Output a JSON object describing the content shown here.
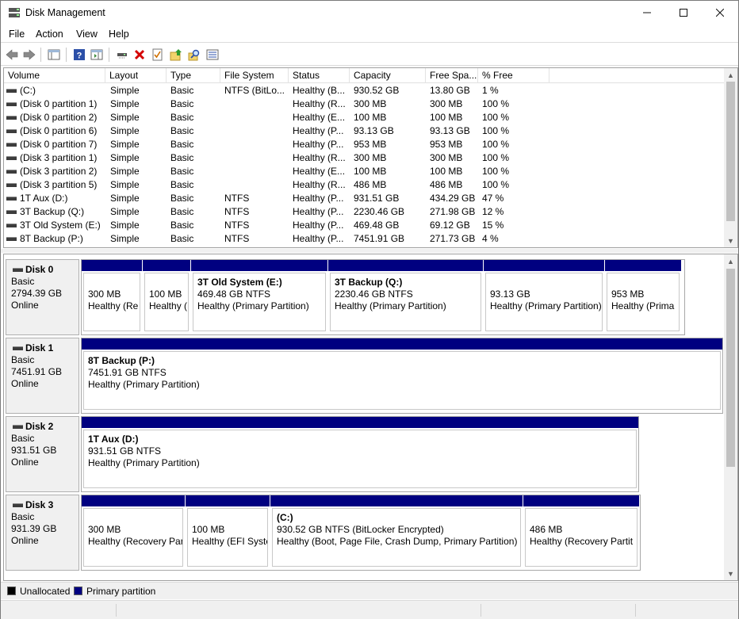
{
  "window": {
    "title": "Disk Management"
  },
  "menu": [
    "File",
    "Action",
    "View",
    "Help"
  ],
  "toolbar": {
    "icons": [
      "back-arrow-icon",
      "forward-arrow-icon",
      "console-tree-icon",
      "help-icon",
      "action-pane-icon",
      "connect-icon",
      "delete-icon",
      "properties-icon",
      "import-icon",
      "search-icon",
      "list-view-icon"
    ]
  },
  "columns": [
    "Volume",
    "Layout",
    "Type",
    "File System",
    "Status",
    "Capacity",
    "Free Spa...",
    "% Free"
  ],
  "volumes": [
    {
      "volume": "(C:)",
      "layout": "Simple",
      "type": "Basic",
      "fs": "NTFS (BitLo...",
      "status": "Healthy (B...",
      "capacity": "930.52 GB",
      "free": "13.80 GB",
      "pct": "1 %"
    },
    {
      "volume": "(Disk 0 partition 1)",
      "layout": "Simple",
      "type": "Basic",
      "fs": "",
      "status": "Healthy (R...",
      "capacity": "300 MB",
      "free": "300 MB",
      "pct": "100 %"
    },
    {
      "volume": "(Disk 0 partition 2)",
      "layout": "Simple",
      "type": "Basic",
      "fs": "",
      "status": "Healthy (E...",
      "capacity": "100 MB",
      "free": "100 MB",
      "pct": "100 %"
    },
    {
      "volume": "(Disk 0 partition 6)",
      "layout": "Simple",
      "type": "Basic",
      "fs": "",
      "status": "Healthy (P...",
      "capacity": "93.13 GB",
      "free": "93.13 GB",
      "pct": "100 %"
    },
    {
      "volume": "(Disk 0 partition 7)",
      "layout": "Simple",
      "type": "Basic",
      "fs": "",
      "status": "Healthy (P...",
      "capacity": "953 MB",
      "free": "953 MB",
      "pct": "100 %"
    },
    {
      "volume": "(Disk 3 partition 1)",
      "layout": "Simple",
      "type": "Basic",
      "fs": "",
      "status": "Healthy (R...",
      "capacity": "300 MB",
      "free": "300 MB",
      "pct": "100 %"
    },
    {
      "volume": "(Disk 3 partition 2)",
      "layout": "Simple",
      "type": "Basic",
      "fs": "",
      "status": "Healthy (E...",
      "capacity": "100 MB",
      "free": "100 MB",
      "pct": "100 %"
    },
    {
      "volume": "(Disk 3 partition 5)",
      "layout": "Simple",
      "type": "Basic",
      "fs": "",
      "status": "Healthy (R...",
      "capacity": "486 MB",
      "free": "486 MB",
      "pct": "100 %"
    },
    {
      "volume": "1T Aux (D:)",
      "layout": "Simple",
      "type": "Basic",
      "fs": "NTFS",
      "status": "Healthy (P...",
      "capacity": "931.51 GB",
      "free": "434.29 GB",
      "pct": "47 %"
    },
    {
      "volume": "3T Backup (Q:)",
      "layout": "Simple",
      "type": "Basic",
      "fs": "NTFS",
      "status": "Healthy (P...",
      "capacity": "2230.46 GB",
      "free": "271.98 GB",
      "pct": "12 %"
    },
    {
      "volume": "3T Old System (E:)",
      "layout": "Simple",
      "type": "Basic",
      "fs": "NTFS",
      "status": "Healthy (P...",
      "capacity": "469.48 GB",
      "free": "69.12 GB",
      "pct": "15 %"
    },
    {
      "volume": "8T Backup (P:)",
      "layout": "Simple",
      "type": "Basic",
      "fs": "NTFS",
      "status": "Healthy (P...",
      "capacity": "7451.91 GB",
      "free": "271.73 GB",
      "pct": "4 %"
    }
  ],
  "disks": [
    {
      "name": "Disk 0",
      "type": "Basic",
      "size": "2794.39 GB",
      "state": "Online",
      "partitions": [
        {
          "title": "",
          "size": "300 MB",
          "status": "Healthy (Re"
        },
        {
          "title": "",
          "size": "100 MB",
          "status": "Healthy (E"
        },
        {
          "title": "3T Old System  (E:)",
          "size": "469.48 GB NTFS",
          "status": "Healthy (Primary Partition)"
        },
        {
          "title": "3T Backup  (Q:)",
          "size": "2230.46 GB NTFS",
          "status": "Healthy (Primary Partition)"
        },
        {
          "title": "",
          "size": "93.13 GB",
          "status": "Healthy (Primary Partition)"
        },
        {
          "title": "",
          "size": "953 MB",
          "status": "Healthy (Prima"
        }
      ]
    },
    {
      "name": "Disk 1",
      "type": "Basic",
      "size": "7451.91 GB",
      "state": "Online",
      "partitions": [
        {
          "title": "8T Backup   (P:)",
          "size": "7451.91 GB NTFS",
          "status": "Healthy (Primary Partition)"
        }
      ]
    },
    {
      "name": "Disk 2",
      "type": "Basic",
      "size": "931.51 GB",
      "state": "Online",
      "partitions": [
        {
          "title": "1T Aux  (D:)",
          "size": "931.51 GB NTFS",
          "status": "Healthy (Primary Partition)"
        }
      ]
    },
    {
      "name": "Disk 3",
      "type": "Basic",
      "size": "931.39 GB",
      "state": "Online",
      "partitions": [
        {
          "title": "",
          "size": "300 MB",
          "status": "Healthy (Recovery Par"
        },
        {
          "title": "",
          "size": "100 MB",
          "status": "Healthy (EFI Syste"
        },
        {
          "title": "(C:)",
          "size": "930.52 GB NTFS (BitLocker Encrypted)",
          "status": "Healthy (Boot, Page File, Crash Dump, Primary Partition)"
        },
        {
          "title": "",
          "size": "486 MB",
          "status": "Healthy (Recovery Partit"
        }
      ]
    }
  ],
  "legend": {
    "unallocated": {
      "label": "Unallocated",
      "color": "#000000"
    },
    "primary": {
      "label": "Primary partition",
      "color": "#000080"
    }
  },
  "colors": {
    "partition_bar": "#000080",
    "delete_icon": "#d40000"
  }
}
